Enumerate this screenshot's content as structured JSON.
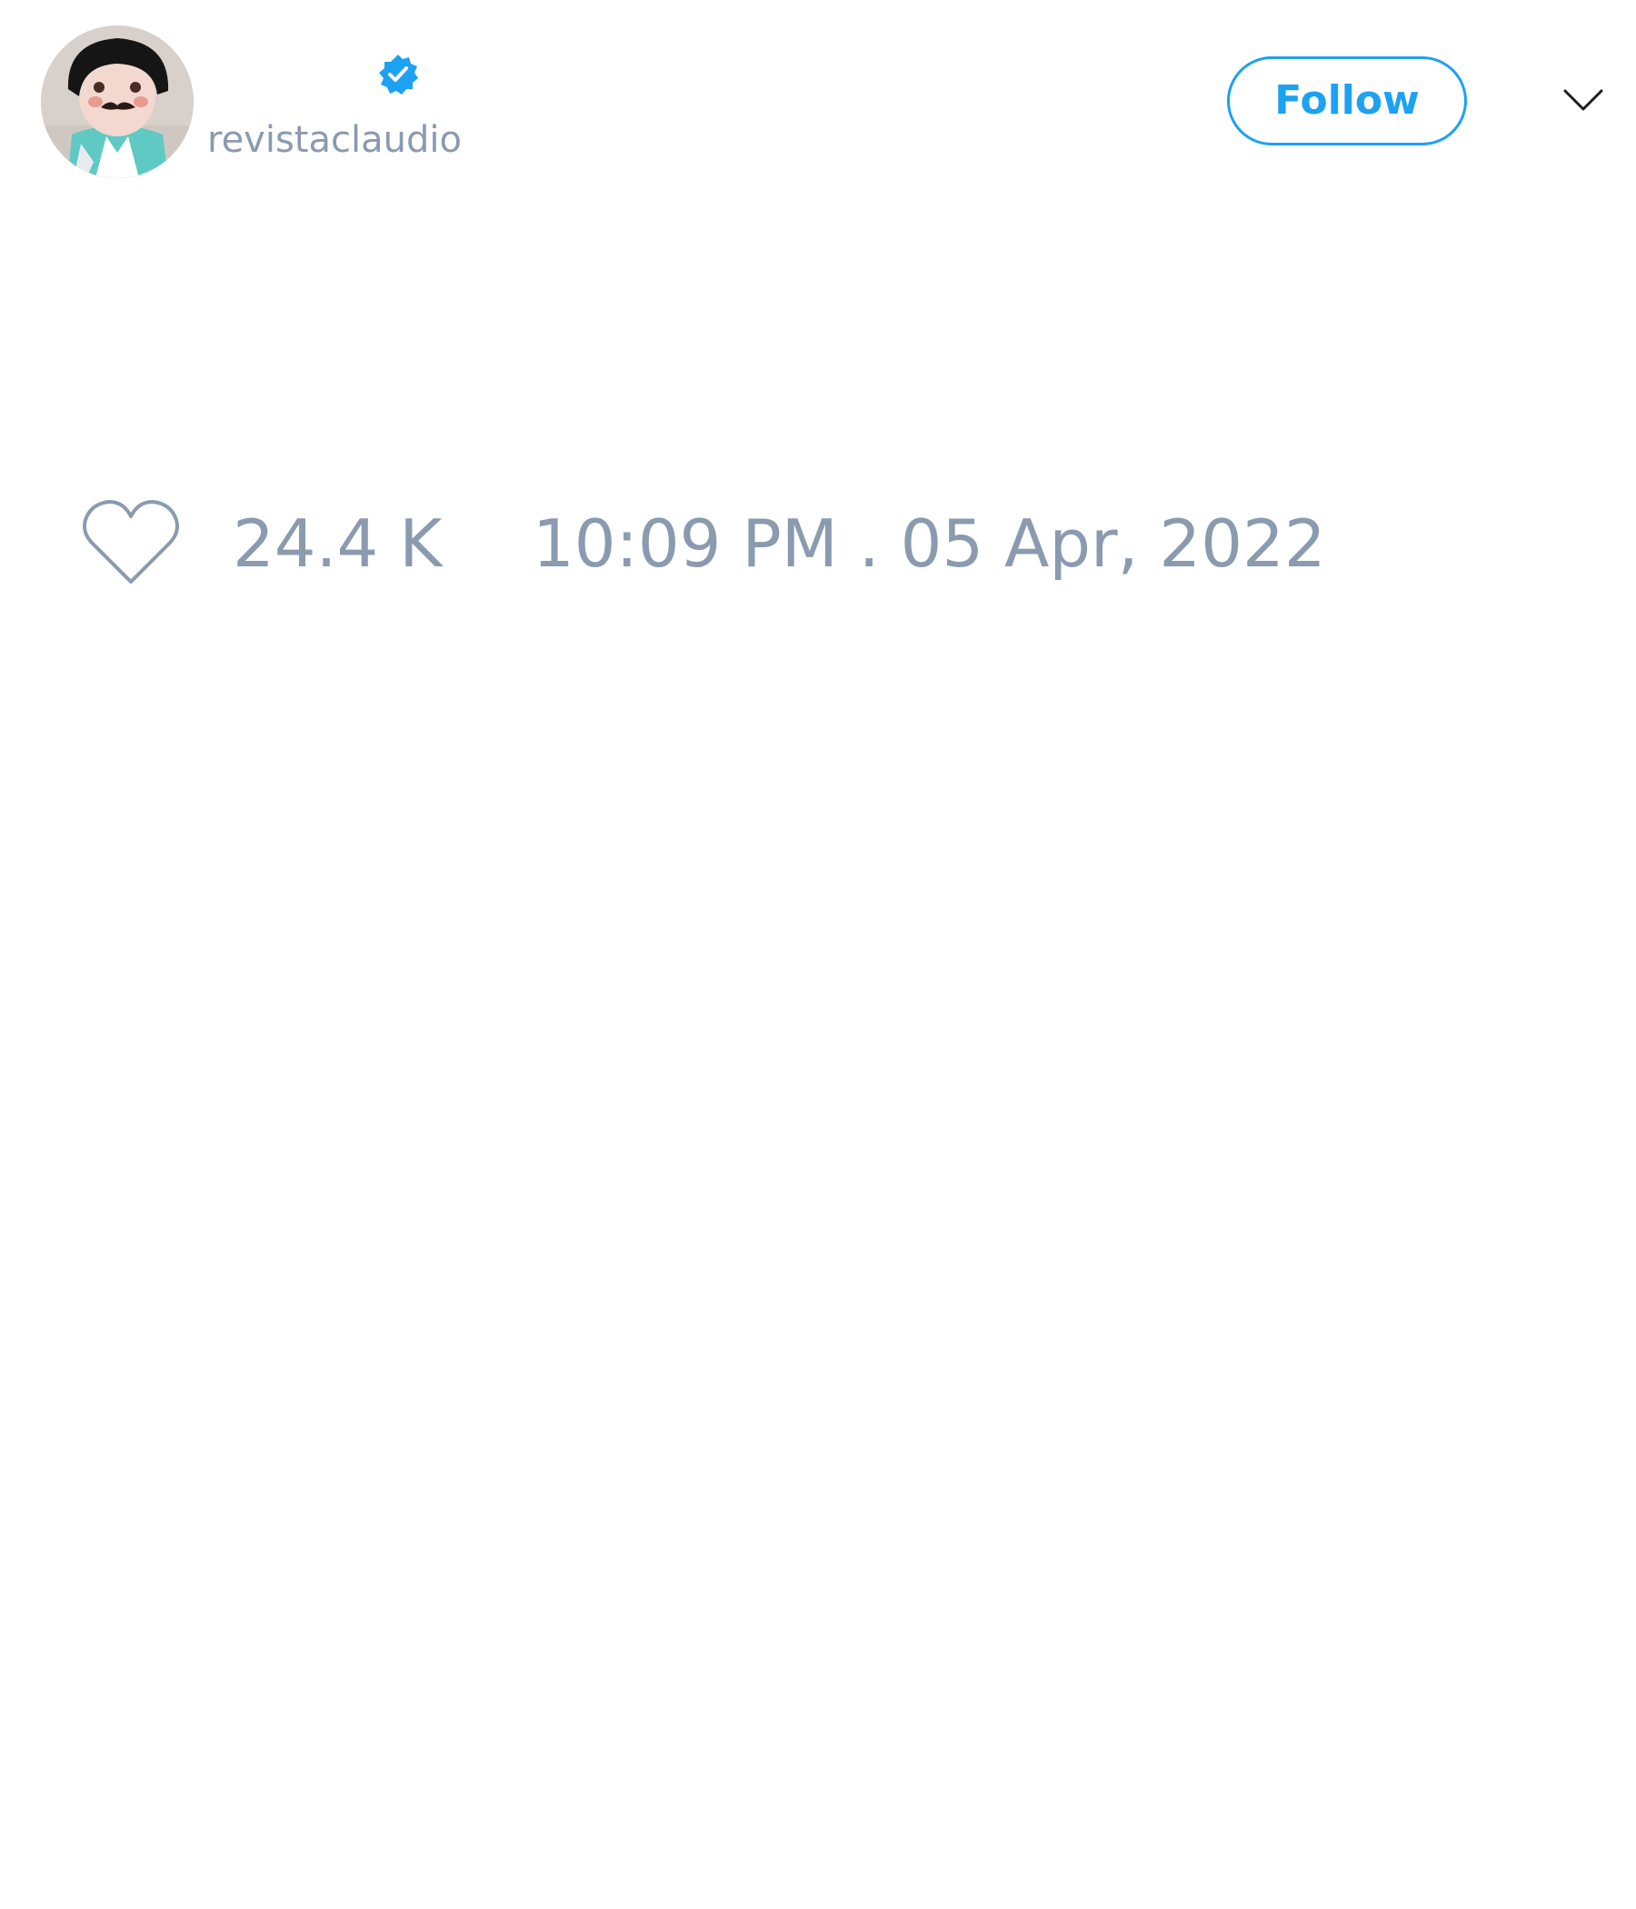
{
  "tweet": {
    "author": {
      "handle": "revistaclaudio",
      "verified": true,
      "avatar_icon": "avatar-photo"
    },
    "follow_label": "Follow",
    "menu_icon": "chevron-down-icon",
    "like_icon": "heart-icon",
    "likes": "24.4 K",
    "timestamp": "10:09 PM . 05 Apr, 2022"
  },
  "colors": {
    "accent": "#1da1f2",
    "muted_text": "#8a9bb0",
    "background": "#ffffff"
  }
}
